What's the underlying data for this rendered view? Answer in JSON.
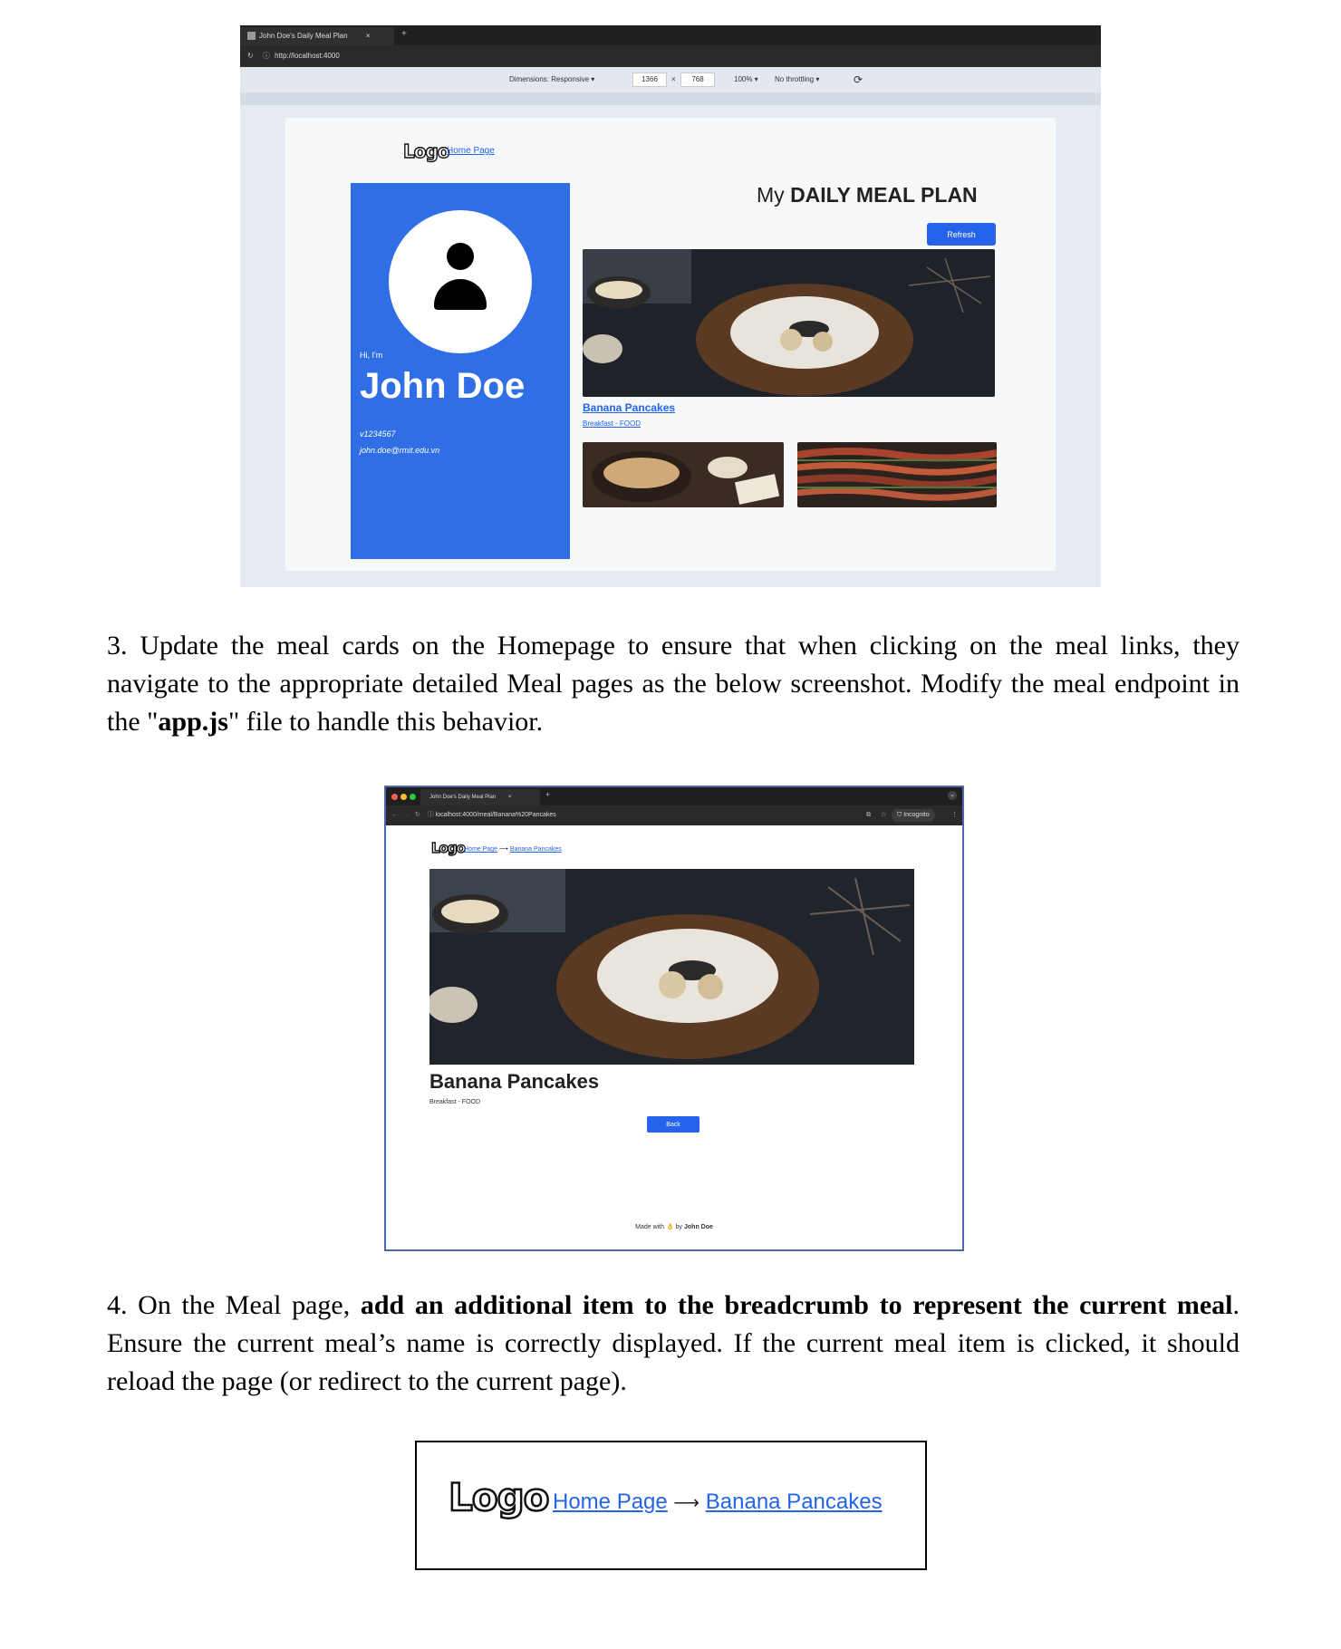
{
  "screenshot1": {
    "tab_title": "John Doe's Daily Meal Plan",
    "tab_close": "×",
    "new_tab": "+",
    "url": "http://localhost:4000",
    "devtools": {
      "dimensions_label": "Dimensions: Responsive ▾",
      "width": "1366",
      "times": "×",
      "height": "768",
      "zoom": "100% ▾",
      "throttling": "No throttling ▾"
    },
    "logo": "Logo",
    "nav_home": "Home Page",
    "profile": {
      "greeting": "Hi, I'm",
      "name": "John Doe",
      "student_id": "v1234567",
      "email": "john.doe@rmit.edu.vn"
    },
    "title_prefix": "My ",
    "title_bold": "DAILY MEAL PLAN",
    "refresh_label": "Refresh",
    "meal": {
      "name": "Banana Pancakes",
      "category": "Breakfast - FOOD"
    }
  },
  "paragraph3": {
    "text_a": "3. Update the meal cards on the Homepage to ensure that when clicking on the meal links, they navigate to the appropriate detailed Meal pages as the below screenshot. Modify the meal endpoint in the \"",
    "text_bold": "app.js",
    "text_b": "\" file to handle this behavior."
  },
  "screenshot2": {
    "tab_title": "John Doe's Daily Meal Plan",
    "tab_close": "×",
    "new_tab": "+",
    "url": "localhost:4000/meal/Banana%20Pancakes",
    "incognito": "Incognito",
    "logo": "Logo",
    "breadcrumb_home": "Home Page",
    "breadcrumb_arrow": "⟶",
    "breadcrumb_current": "Banana Pancakes",
    "meal_name": "Banana Pancakes",
    "meal_category": "Breakfast - FOOD",
    "back_label": "Back",
    "footer_made": "Made with",
    "footer_by": "by",
    "footer_author": "John Doe"
  },
  "paragraph4": {
    "text_a": "4. On the Meal page, ",
    "text_bold": "add an additional item to the breadcrumb to represent the current meal",
    "text_b": ". Ensure the current meal’s name is correctly displayed. If the current meal item is clicked, it should reload the page (or redirect to the current page)."
  },
  "screenshot3": {
    "logo": "Logo",
    "breadcrumb_home": "Home Page",
    "breadcrumb_arrow": "⟶",
    "breadcrumb_current": "Banana Pancakes"
  },
  "colors": {
    "accent_blue": "#2563eb",
    "profile_card_blue": "#2f6ee5",
    "link_blue": "#2463eb"
  }
}
